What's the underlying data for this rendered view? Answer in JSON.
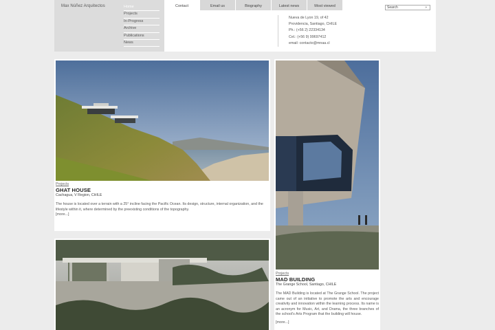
{
  "brand": "Max Núñez Arquitectos",
  "nav": [
    {
      "label": "Home",
      "active": true
    },
    {
      "label": "Projects",
      "active": false
    },
    {
      "label": "In-Progress",
      "active": false
    },
    {
      "label": "Archive",
      "active": false
    },
    {
      "label": "Publications",
      "active": false
    },
    {
      "label": "News",
      "active": false
    }
  ],
  "tabs": [
    {
      "label": "Contact",
      "active": true
    },
    {
      "label": "Email us",
      "active": false
    },
    {
      "label": "Biography",
      "active": false
    },
    {
      "label": "Latest news",
      "active": false
    },
    {
      "label": "Most viewed",
      "active": false
    }
  ],
  "search": {
    "placeholder": "Search",
    "button": "»"
  },
  "contact": {
    "address1": "Nueva de Lyon 19, of 42",
    "address2": "Providencia, Santiago, CHILE",
    "phone": "Ph.: (+56 2) 22334134",
    "cel": "Cel.: (+56 9) 99697412",
    "email": "email: contacto@mnaa.cl"
  },
  "cards": {
    "ghat": {
      "category": "Projects",
      "title": "GHAT HOUSE",
      "location": "Cachagua, V Region, CHILE",
      "description": "The house is located over a terrain with a 25° incline facing the Pacific Ocean. Its design, structure, internal organization, and the lifestyle within it, where determined by the preexisting conditions of the topography.",
      "more": "[more...]"
    },
    "mad": {
      "category": "Projects",
      "title": "MAD BUILDING",
      "location": "The Grange School, Santiago, CHILE",
      "description": "The MAD Building is located at The Grange School. The project came out of an initiative to promote the arts and encourage creativity and innovation within the learning process. Its name is an acronym for Music, Art, and Drama, the three branches of the school's Arts Program that the building will house.",
      "more": "[more...]"
    }
  }
}
